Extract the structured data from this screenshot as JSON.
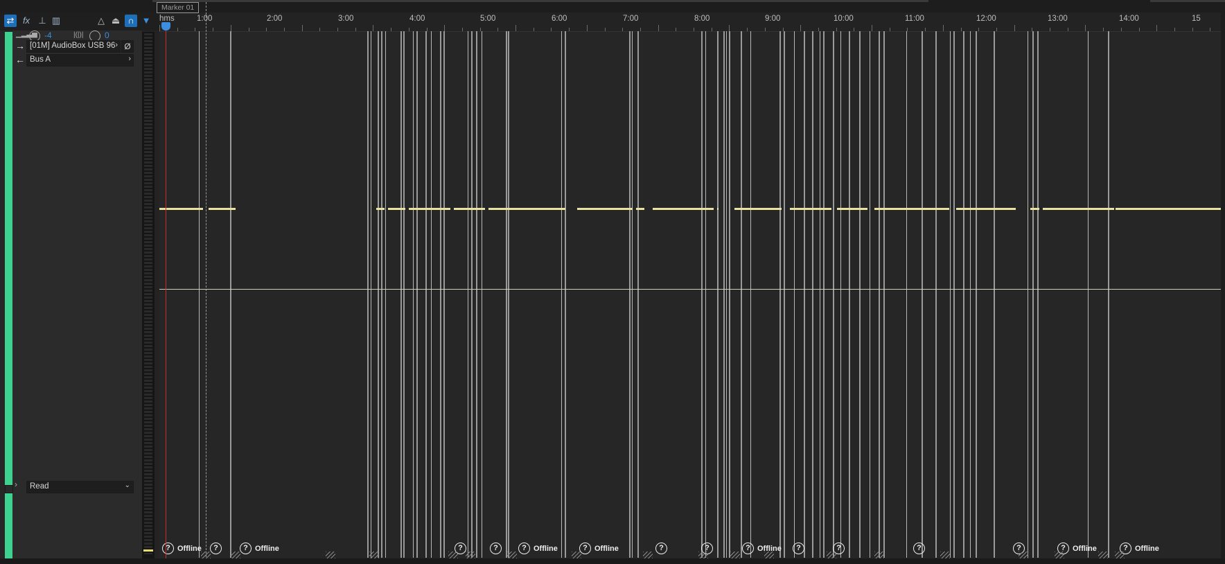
{
  "marker": {
    "label": "Marker 01"
  },
  "ruler": {
    "start_label": "hms",
    "labels": [
      "1:00",
      "2:00",
      "3:00",
      "4:00",
      "5:00",
      "6:00",
      "7:00",
      "8:00",
      "9:00",
      "10:00",
      "11:00",
      "12:00",
      "13:00",
      "14:00",
      "15"
    ]
  },
  "track": {
    "volume": "-4",
    "pan": "0",
    "input": "[01M] AudioBox USB 96",
    "output": "Bus A",
    "automation": "Read"
  },
  "icons": [
    "swap-icon",
    "fx-icon",
    "sends-icon",
    "eq-icon",
    "metronome-icon",
    "mic-icon",
    "headphones-icon",
    "marker-pin-icon"
  ],
  "clips": {
    "offline_label": "Offline",
    "question_mark": "?"
  },
  "colors": {
    "track_color": "#3fd18f",
    "playhead": "#c9302c",
    "accent": "#1f6fb8",
    "waveform": "#e8e3a0"
  }
}
